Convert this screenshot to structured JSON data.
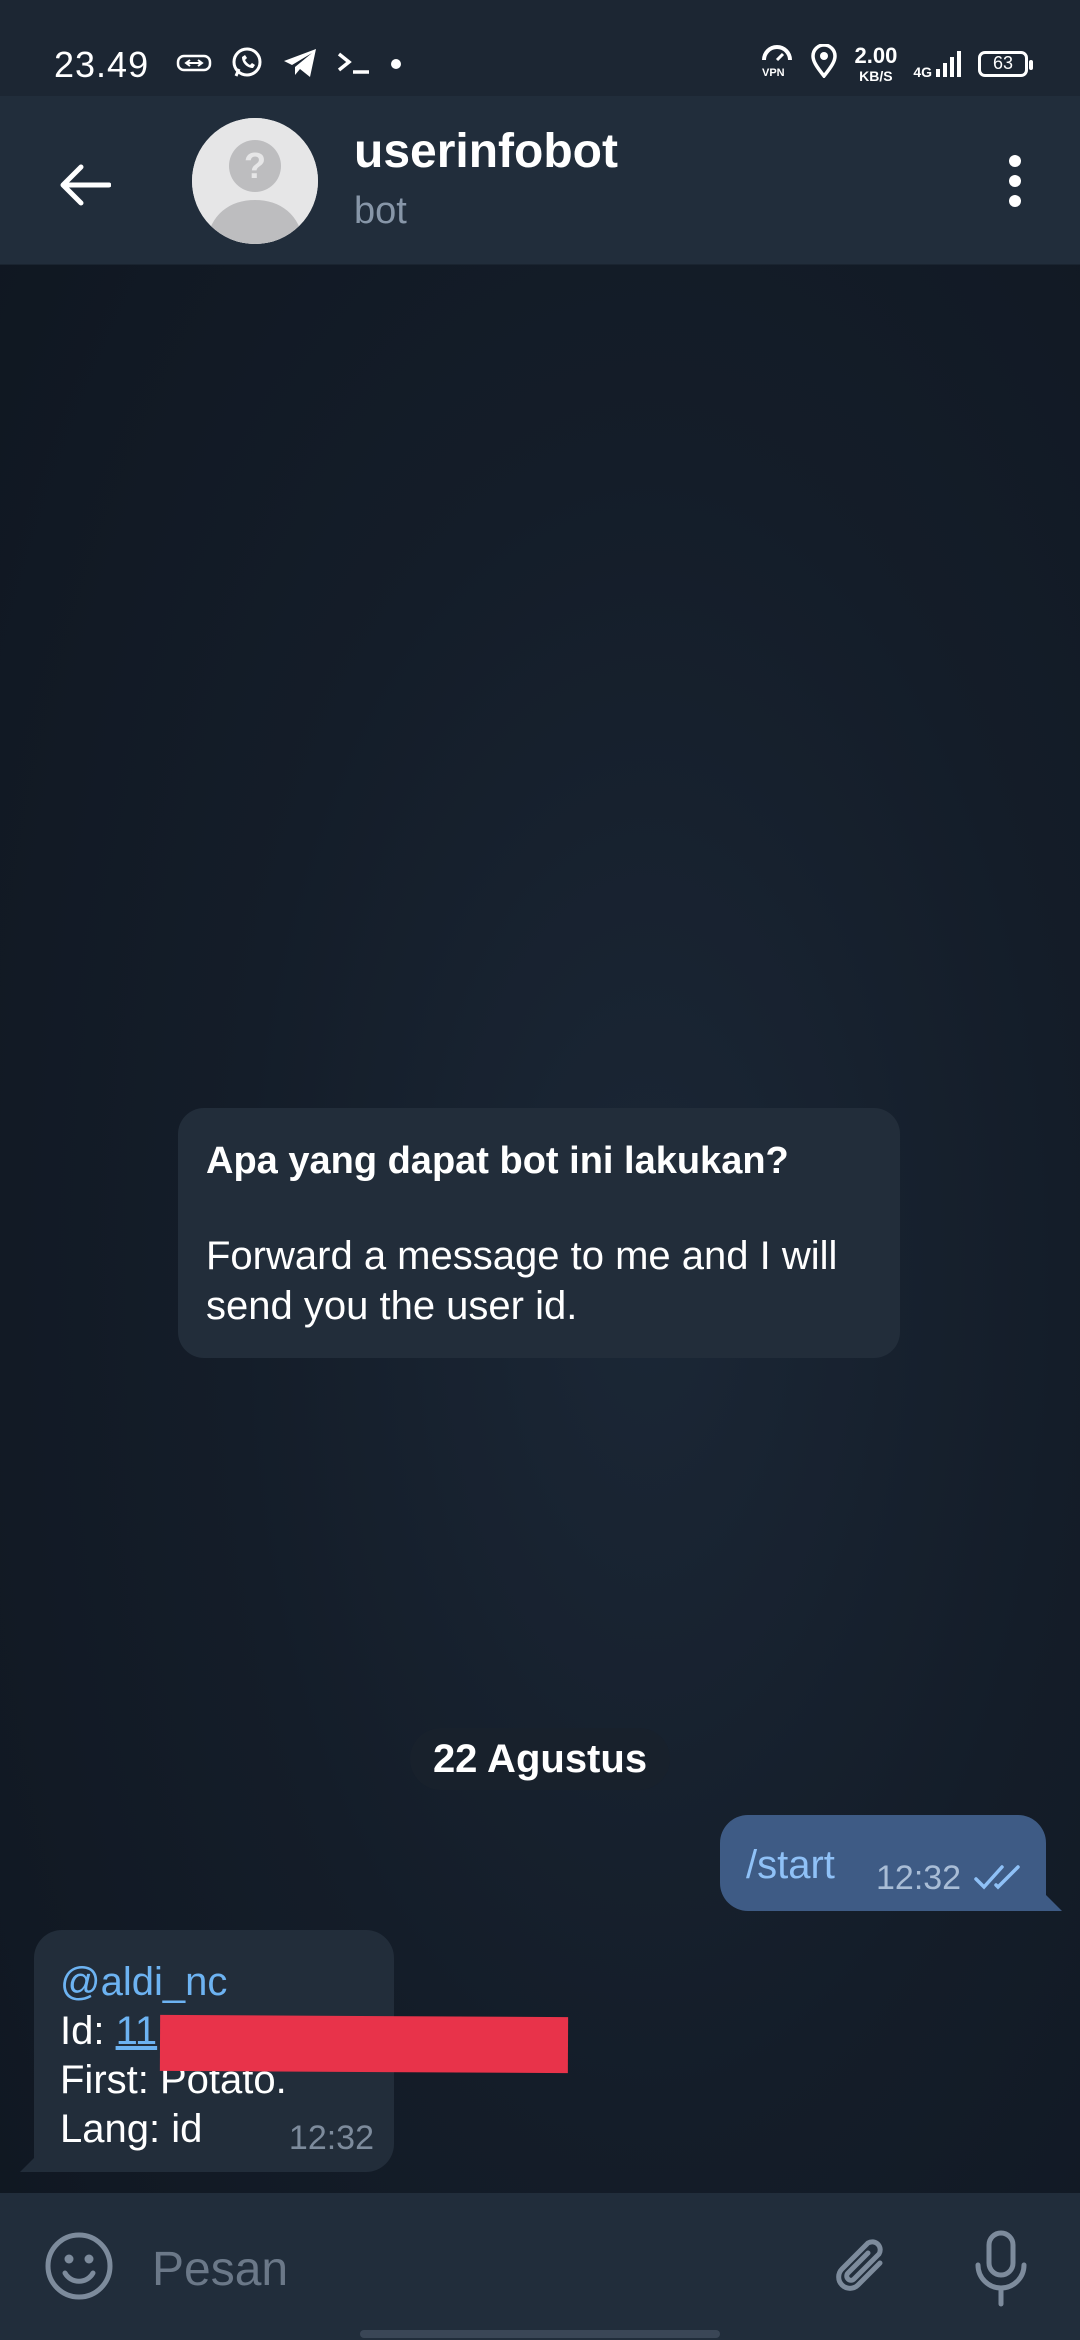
{
  "status_bar": {
    "time": "23.49",
    "net_speed_value": "2.00",
    "net_speed_unit": "KB/S",
    "network": "4G",
    "battery": "63",
    "icons": [
      "data-saver-icon",
      "whatsapp-icon",
      "telegram-icon",
      "terminal-icon",
      "dot-icon",
      "vpn-icon",
      "location-icon",
      "signal-icon",
      "battery-icon"
    ]
  },
  "header": {
    "title": "userinfobot",
    "subtitle": "bot",
    "icons": [
      "back-arrow-icon",
      "avatar-placeholder-icon",
      "more-vert-icon"
    ]
  },
  "intro": {
    "title": "Apa yang dapat bot ini lakukan?",
    "text_line1": "Forward a message to me and I will",
    "text_line2": "send you the user id."
  },
  "date_divider": "22 Agustus",
  "messages": {
    "outgoing": {
      "text": "/start",
      "time": "12:32",
      "status_icon": "double-check-icon"
    },
    "incoming": {
      "username": "@aldi_nc",
      "id_label": "Id: ",
      "id_value": "11",
      "first": "First: Potato.",
      "lang": "Lang: id",
      "time": "12:32"
    }
  },
  "composer": {
    "placeholder": "Pesan",
    "icons": [
      "emoji-icon",
      "attach-icon",
      "mic-icon"
    ]
  },
  "colors": {
    "header_bg": "#212d3b",
    "bubble_out": "#3e5b85",
    "bubble_in": "#222d3a",
    "link": "#6db3f2",
    "redaction": "#e8334a"
  }
}
